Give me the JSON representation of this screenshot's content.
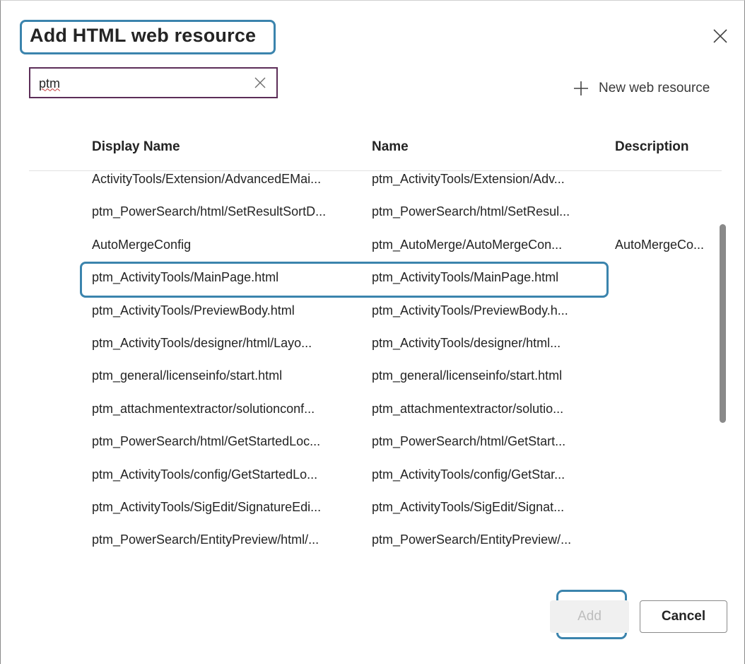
{
  "dialog": {
    "title": "Add HTML web resource",
    "close_icon": "close-icon"
  },
  "search": {
    "value": "ptm",
    "clear_icon": "close-icon"
  },
  "new_resource": {
    "icon": "plus-icon",
    "label": "New web resource"
  },
  "table": {
    "headers": [
      "Display Name",
      "Name",
      "Description"
    ],
    "rows": [
      {
        "display": "ActivityTools/Extension/AdvancedEMai...",
        "name": "ptm_ActivityTools/Extension/Adv...",
        "description": ""
      },
      {
        "display": "ptm_PowerSearch/html/SetResultSortD...",
        "name": "ptm_PowerSearch/html/SetResul...",
        "description": ""
      },
      {
        "display": "AutoMergeConfig",
        "name": "ptm_AutoMerge/AutoMergeCon...",
        "description": "AutoMergeCo..."
      },
      {
        "display": "ptm_ActivityTools/MainPage.html",
        "name": "ptm_ActivityTools/MainPage.html",
        "description": ""
      },
      {
        "display": "ptm_ActivityTools/PreviewBody.html",
        "name": "ptm_ActivityTools/PreviewBody.h...",
        "description": ""
      },
      {
        "display": "ptm_ActivityTools/designer/html/Layo...",
        "name": "ptm_ActivityTools/designer/html...",
        "description": ""
      },
      {
        "display": "ptm_general/licenseinfo/start.html",
        "name": "ptm_general/licenseinfo/start.html",
        "description": ""
      },
      {
        "display": "ptm_attachmentextractor/solutionconf...",
        "name": "ptm_attachmentextractor/solutio...",
        "description": ""
      },
      {
        "display": "ptm_PowerSearch/html/GetStartedLoc...",
        "name": "ptm_PowerSearch/html/GetStart...",
        "description": ""
      },
      {
        "display": "ptm_ActivityTools/config/GetStartedLo...",
        "name": "ptm_ActivityTools/config/GetStar...",
        "description": ""
      },
      {
        "display": "ptm_ActivityTools/SigEdit/SignatureEdi...",
        "name": "ptm_ActivityTools/SigEdit/Signat...",
        "description": ""
      },
      {
        "display": "ptm_PowerSearch/EntityPreview/html/...",
        "name": "ptm_PowerSearch/EntityPreview/...",
        "description": ""
      }
    ],
    "selected_row": 3
  },
  "footer": {
    "add_label": "Add",
    "cancel_label": "Cancel"
  },
  "colors": {
    "highlight": "#3b84ad",
    "search_border": "#5c2d58"
  }
}
